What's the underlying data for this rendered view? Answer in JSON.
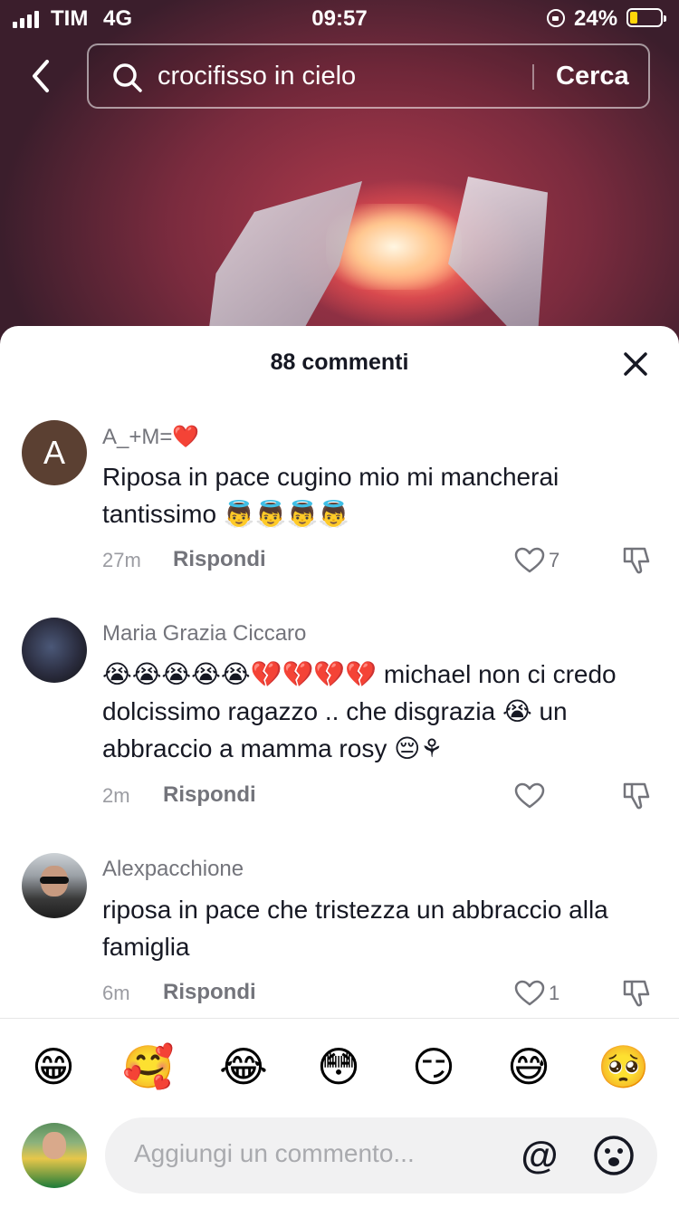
{
  "status_bar": {
    "carrier": "TIM",
    "network": "4G",
    "time": "09:57",
    "battery": "24%"
  },
  "search": {
    "query": "crocifisso in cielo",
    "submit_label": "Cerca"
  },
  "comments_panel": {
    "title": "88 commenti",
    "reply_label": "Rispondi",
    "comments": [
      {
        "username": "A_+M=❤️",
        "avatar_letter": "A",
        "text": "Riposa in pace cugino mio mi mancherai tantissimo 👼👼👼👼",
        "time": "27m",
        "likes": "7"
      },
      {
        "username": "Maria Grazia Ciccaro",
        "text": "😭😭😭😭😭💔💔💔💔 michael non ci credo dolcissimo ragazzo .. che disgrazia 😭 un abbraccio a mamma rosy 😔⚘",
        "time": "2m",
        "likes": ""
      },
      {
        "username": "Alexpacchione",
        "text": "riposa in pace che tristezza un abbraccio alla famiglia",
        "time": "6m",
        "likes": "1"
      }
    ]
  },
  "emoji_bar": [
    "😁",
    "🥰",
    "😂",
    "😳",
    "😏",
    "😅",
    "🥺"
  ],
  "input": {
    "placeholder": "Aggiungi un commento...",
    "mention_symbol": "@"
  }
}
